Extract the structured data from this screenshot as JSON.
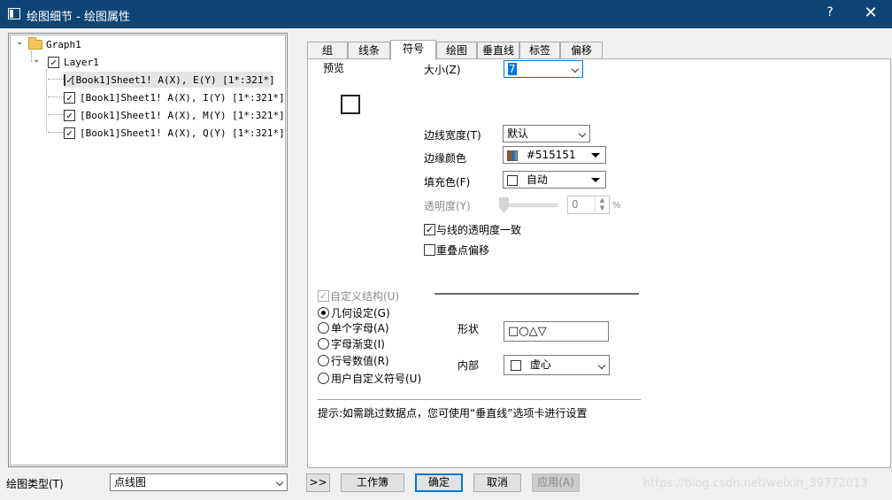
{
  "window": {
    "title": "绘图细节 - 绘图属性",
    "help": "?",
    "close": "✕"
  },
  "tree": {
    "root": "Graph1",
    "layer": "Layer1",
    "items": [
      "[Book1]Sheet1! A(X), E(Y) [1*:321*]",
      "[Book1]Sheet1! A(X), I(Y) [1*:321*]",
      "[Book1]Sheet1! A(X), M(Y) [1*:321*]",
      "[Book1]Sheet1! A(X), Q(Y) [1*:321*]"
    ]
  },
  "plot_type": {
    "label": "绘图类型(T)",
    "value": "点线图"
  },
  "tabs": [
    "组",
    "线条",
    "符号",
    "绘图",
    "垂直线",
    "标签",
    "偏移"
  ],
  "symbol": {
    "preview_label": "预览",
    "size_label": "大小(Z)",
    "size_value": "7",
    "edge_width_label": "边线宽度(T)",
    "edge_width_value": "默认",
    "edge_color_label": "边缘颜色",
    "edge_color_value": "#515151",
    "fill_color_label": "填充色(F)",
    "fill_color_value": "自动",
    "transparency_label": "透明度(Y)",
    "transparency_value": "0",
    "transparency_unit": "%",
    "match_line_label": "与线的透明度一致",
    "overlap_label": "重叠点偏移",
    "custom_label": "自定义结构(U)",
    "radios": [
      "几何设定(G)",
      "单个字母(A)",
      "字母渐变(I)",
      "行号数值(R)",
      "用户自定义符号(U)"
    ],
    "shape_label": "形状",
    "shape_value": "□○△▽",
    "interior_label": "内部",
    "interior_value": "虚心",
    "hint": "提示:如需跳过数据点，您可使用“垂直线”选项卡进行设置"
  },
  "buttons": {
    "expand": ">>",
    "workbook": "工作簿",
    "ok": "确定",
    "cancel": "取消",
    "apply": "应用(A)"
  },
  "watermark": "https://blog.csdn.net/weixin_39772013",
  "colors": {
    "titlebar": "#0f4575",
    "edge_color": "#515151",
    "focus": "#0078d7"
  }
}
